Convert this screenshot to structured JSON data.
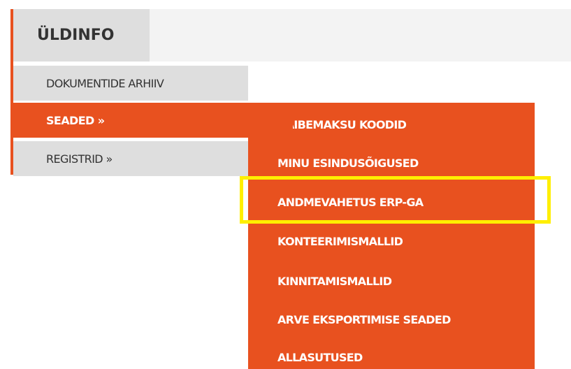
{
  "top_nav": {
    "tab_label": "ÜLDINFO"
  },
  "menu": {
    "items": [
      {
        "label": "DOKUMENTIDE ARHIIV"
      },
      {
        "label": "SEADED »"
      },
      {
        "label": "REGISTRID »"
      }
    ]
  },
  "submenu": {
    "items": [
      {
        "label": "KÄIBEMAKSU KOODID"
      },
      {
        "label": "MINU ESINDUSÕIGUSED"
      },
      {
        "label": "ANDMEVAHETUS ERP-GA"
      },
      {
        "label": "KONTEERIMISMALLID"
      },
      {
        "label": "KINNITAMISMALLID"
      },
      {
        "label": "ARVE EKSPORTIMISE SEADED"
      },
      {
        "label": "ALLASUTUSED"
      }
    ]
  },
  "colors": {
    "accent": "#e8511f",
    "menu_background": "#dedede",
    "highlight": "#ffef00"
  }
}
